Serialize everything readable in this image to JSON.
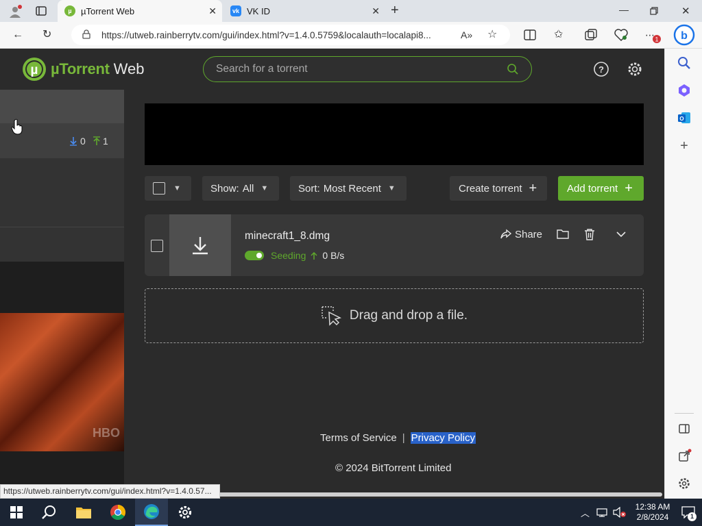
{
  "browser": {
    "tabs": [
      {
        "title": "µTorrent Web",
        "active": true
      },
      {
        "title": "VK ID",
        "active": false
      }
    ],
    "url": "https://utweb.rainberrytv.com/gui/index.html?v=1.4.0.5759&localauth=localapi8...",
    "status_url": "https://utweb.rainberrytv.com/gui/index.html?v=1.4.0.57...",
    "accent": "#0078d4"
  },
  "app": {
    "logo_brand": "µTorrent",
    "logo_suffix": "Web",
    "brand_color": "#78b83a",
    "search_placeholder": "Search for a torrent"
  },
  "left_panel": {
    "download_count": "0",
    "upload_count": "1",
    "video_watermark": "HBO"
  },
  "toolbar": {
    "show_label": "Show:",
    "show_value": "All",
    "sort_label": "Sort:",
    "sort_value": "Most Recent",
    "create_label": "Create torrent",
    "add_label": "Add torrent"
  },
  "torrents": [
    {
      "name": "minecraft1_8.dmg",
      "status": "Seeding",
      "speed": "0 B/s",
      "share_label": "Share"
    }
  ],
  "dropzone": {
    "label": "Drag and drop a file."
  },
  "footer": {
    "terms": "Terms of Service",
    "separator": "|",
    "privacy": "Privacy Policy",
    "copyright": "© 2024 BitTorrent Limited"
  },
  "taskbar": {
    "time": "12:38 AM",
    "date": "2/8/2024",
    "notification_count": "1"
  }
}
